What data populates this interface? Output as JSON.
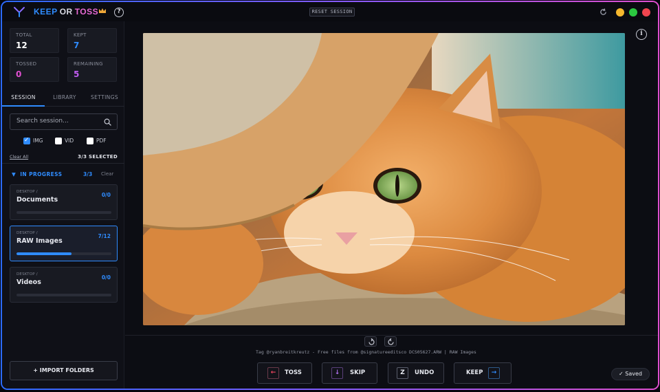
{
  "app": {
    "brand_keep": "KEEP",
    "brand_or": "OR",
    "brand_toss": "TOSS",
    "reset_label": "RESET SESSION"
  },
  "window_controls": {
    "colors": [
      "#f5b82e",
      "#2bc840",
      "#f0454f"
    ]
  },
  "stats": {
    "total": {
      "label": "TOTAL",
      "value": "12"
    },
    "kept": {
      "label": "KEPT",
      "value": "7"
    },
    "tossed": {
      "label": "TOSSED",
      "value": "0"
    },
    "remaining": {
      "label": "REMAINING",
      "value": "5"
    }
  },
  "tabs": [
    {
      "label": "SESSION",
      "active": true
    },
    {
      "label": "LIBRARY",
      "active": false
    },
    {
      "label": "SETTINGS",
      "active": false
    }
  ],
  "search": {
    "placeholder": "Search session..."
  },
  "filters": [
    {
      "label": "IMG",
      "checked": true
    },
    {
      "label": "VID",
      "checked": false
    },
    {
      "label": "PDF",
      "checked": false
    }
  ],
  "selection": {
    "clear_all": "Clear All",
    "selected": "3/3 SELECTED"
  },
  "in_progress": {
    "heading": "IN PROGRESS",
    "count": "3/3",
    "clear": "Clear"
  },
  "folders": [
    {
      "path": "DESKTOP /",
      "name": "Documents",
      "count": "0/0",
      "progress": 0
    },
    {
      "path": "DESKTOP /",
      "name": "RAW Images",
      "count": "7/12",
      "progress": 0.583
    },
    {
      "path": "DESKTOP /",
      "name": "Videos",
      "count": "0/0",
      "progress": 0
    }
  ],
  "import_label": "+ IMPORT FOLDERS",
  "caption": "Tag @ryanbreitkreutz - Free files from @signatureeditsco DCS05627.ARW   |   RAW Images",
  "actions": {
    "toss": {
      "key": "←",
      "label": "TOSS"
    },
    "skip": {
      "key": "↓",
      "label": "SKIP"
    },
    "undo": {
      "key": "Z",
      "label": "UNDO"
    },
    "keep": {
      "key": "→",
      "label": "KEEP"
    }
  },
  "saved_label": "✓ Saved",
  "colors": {
    "accent_blue": "#2f8cff",
    "accent_pink": "#e86ad4",
    "kept": "#2f8cff",
    "tossed": "#e04fd0",
    "remaining": "#c05cf0"
  }
}
